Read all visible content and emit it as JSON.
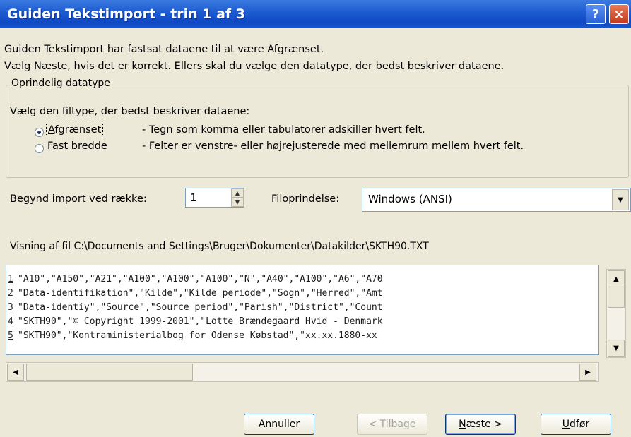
{
  "window": {
    "title": "Guiden Tekstimport - trin 1 af 3",
    "help_glyph": "?",
    "close_glyph": "×"
  },
  "intro": {
    "line1": "Guiden Tekstimport har fastsat dataene til at være Afgrænset.",
    "line2": "Vælg Næste, hvis det er korrekt. Ellers skal du vælge den datatype, der bedst beskriver dataene."
  },
  "group": {
    "legend": "Oprindelig datatype",
    "prompt": "Vælg den filtype, der bedst beskriver dataene:",
    "options": [
      {
        "label": "Afgrænset",
        "description": "- Tegn som komma eller tabulatorer adskiller hvert felt.",
        "selected": true
      },
      {
        "label": "Fast bredde",
        "description": "- Felter er venstre- eller højrejusterede med mellemrum mellem hvert felt.",
        "selected": false
      }
    ]
  },
  "import_row": {
    "label": "Begynd import ved række:",
    "value": "1"
  },
  "file_origin": {
    "label": "Filoprindelse:",
    "value": "Windows (ANSI)"
  },
  "preview": {
    "label": "Visning af fil C:\\Documents and Settings\\Bruger\\Dokumenter\\Datakilder\\SKTH90.TXT",
    "rows": [
      {
        "num": "1",
        "text": "\"A10\",\"A150\",\"A21\",\"A100\",\"A100\",\"A100\",\"N\",\"A40\",\"A100\",\"A6\",\"A70"
      },
      {
        "num": "2",
        "text": "\"Data-identifikation\",\"Kilde\",\"Kilde periode\",\"Sogn\",\"Herred\",\"Amt"
      },
      {
        "num": "3",
        "text": "\"Data-identiy\",\"Source\",\"Source period\",\"Parish\",\"District\",\"Count"
      },
      {
        "num": "4",
        "text": "\"SKTH90\",\"© Copyright 1999-2001\",\"Lotte Brændegaard Hvid - Denmark"
      },
      {
        "num": "5",
        "text": "\"SKTH90\",\"Kontraministerialbog for Odense Købstad\",\"xx.xx.1880-xx"
      }
    ]
  },
  "buttons": {
    "cancel": "Annuller",
    "back": "< Tilbage",
    "next": "Næste >",
    "finish": "Udfør"
  },
  "icons": {
    "help": "help-icon",
    "close": "close-icon",
    "spin_up": "arrow-up-icon",
    "spin_down": "arrow-down-icon",
    "dropdown": "chevron-down-icon",
    "scroll_up": "arrow-up-icon",
    "scroll_down": "arrow-down-icon",
    "scroll_left": "arrow-left-icon",
    "scroll_right": "arrow-right-icon"
  },
  "colors": {
    "titlebar": "#0f49c4",
    "dialog_bg": "#ece9d8",
    "close_red": "#c13a1a"
  }
}
